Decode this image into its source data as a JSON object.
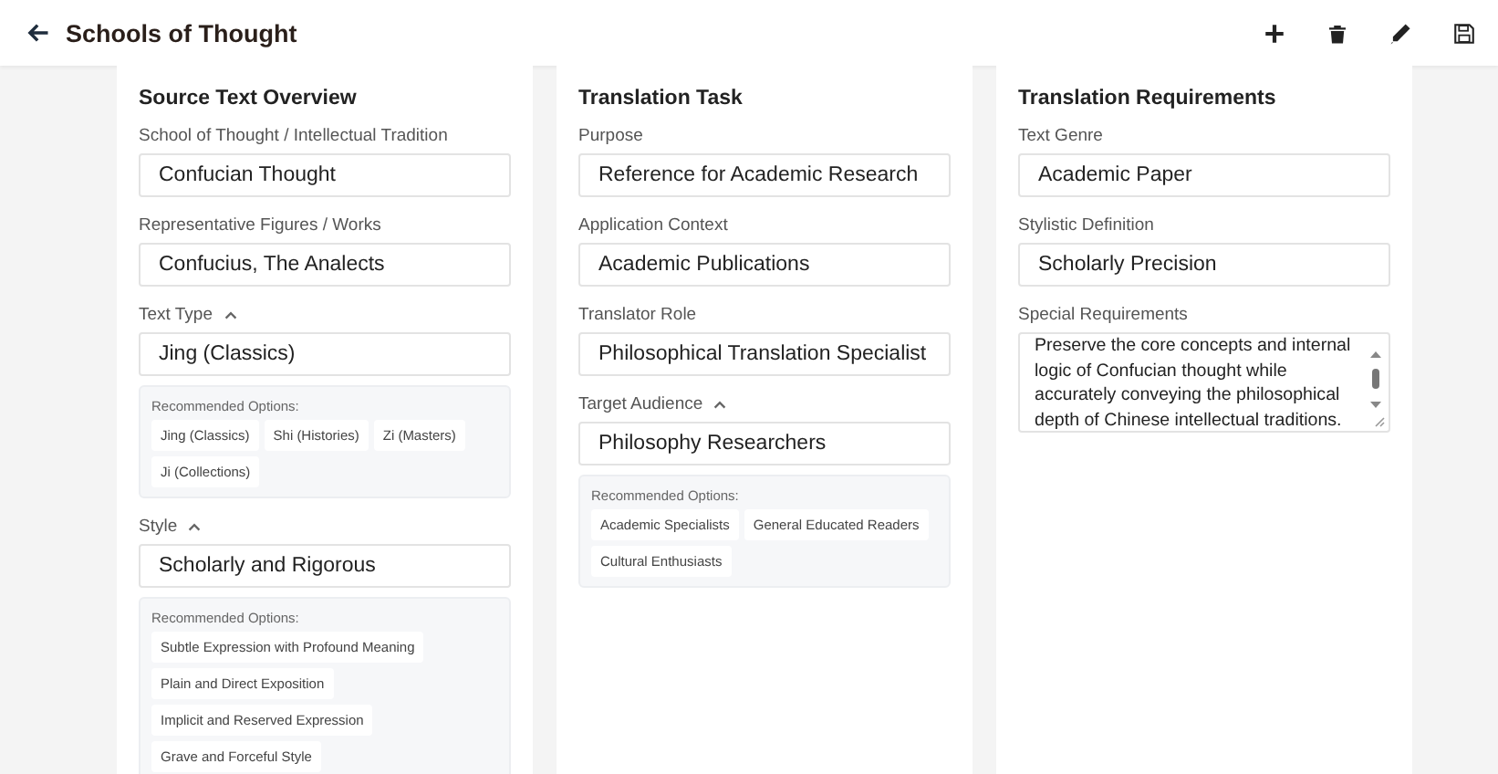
{
  "header": {
    "title": "Schools of Thought"
  },
  "columns": [
    {
      "title": "Source Text Overview",
      "fields": [
        {
          "kind": "input",
          "label": "School of Thought / Intellectual Tradition",
          "value": "Confucian Thought"
        },
        {
          "kind": "input",
          "label": "Representative Figures / Works",
          "value": "Confucius, The Analects"
        },
        {
          "kind": "input",
          "label": "Text Type",
          "expanded": true,
          "value": "Jing (Classics)",
          "options_label": "Recommended Options:",
          "options": [
            "Jing (Classics)",
            "Shi (Histories)",
            "Zi (Masters)",
            "Ji (Collections)"
          ]
        },
        {
          "kind": "input",
          "label": "Style",
          "expanded": true,
          "value": "Scholarly and Rigorous",
          "options_label": "Recommended Options:",
          "options": [
            "Subtle Expression with Profound Meaning",
            "Plain and Direct Exposition",
            "Implicit and Reserved Expression",
            "Grave and Forceful Style"
          ]
        }
      ]
    },
    {
      "title": "Translation Task",
      "fields": [
        {
          "kind": "input",
          "label": "Purpose",
          "value": "Reference for Academic Research"
        },
        {
          "kind": "input",
          "label": "Application Context",
          "value": "Academic Publications"
        },
        {
          "kind": "input",
          "label": "Translator Role",
          "value": "Philosophical Translation Specialist"
        },
        {
          "kind": "input",
          "label": "Target Audience",
          "expanded": true,
          "value": "Philosophy Researchers",
          "options_label": "Recommended Options:",
          "options": [
            "Academic Specialists",
            "General Educated Readers",
            "Cultural Enthusiasts"
          ]
        }
      ]
    },
    {
      "title": "Translation Requirements",
      "fields": [
        {
          "kind": "input",
          "label": "Text Genre",
          "value": "Academic Paper"
        },
        {
          "kind": "input",
          "label": "Stylistic Definition",
          "value": "Scholarly Precision"
        },
        {
          "kind": "textarea",
          "label": "Special Requirements",
          "value": "Preserve the core concepts and internal\nlogic of Confucian thought while\naccurately conveying the philosophical\ndepth of Chinese intellectual traditions."
        }
      ]
    }
  ]
}
